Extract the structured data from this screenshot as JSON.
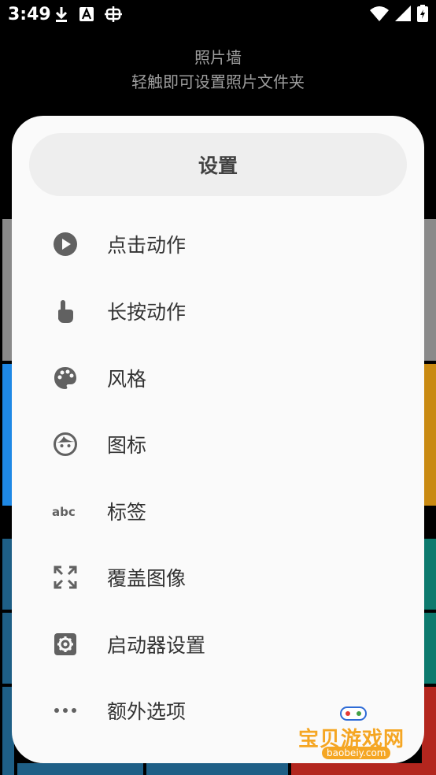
{
  "status_bar": {
    "time": "3:49",
    "icons": [
      "download-icon",
      "a-badge-icon",
      "bug-icon",
      "wifi-icon",
      "signal-icon",
      "battery-icon"
    ]
  },
  "app_header": {
    "title": "照片墙",
    "subtitle": "轻触即可设置照片文件夹"
  },
  "settings_sheet": {
    "title": "设置",
    "items": [
      {
        "label": "点击动作",
        "icon": "play-circle-icon"
      },
      {
        "label": "长按动作",
        "icon": "touch-hand-icon"
      },
      {
        "label": "风格",
        "icon": "palette-icon"
      },
      {
        "label": "图标",
        "icon": "face-icon"
      },
      {
        "label": "标签",
        "icon": "abc-text-icon"
      },
      {
        "label": "覆盖图像",
        "icon": "fullscreen-icon"
      },
      {
        "label": "启动器设置",
        "icon": "gear-icon"
      },
      {
        "label": "额外选项",
        "icon": "more-horizontal-icon"
      }
    ]
  },
  "watermark": {
    "text": "宝贝游戏网",
    "sub": "baobeiy.com"
  },
  "colors": {
    "icon": "#616161",
    "label": "#333333",
    "sheet_bg": "#fafafa",
    "header_bg": "#eeeeee",
    "watermark": "#f5a623"
  }
}
